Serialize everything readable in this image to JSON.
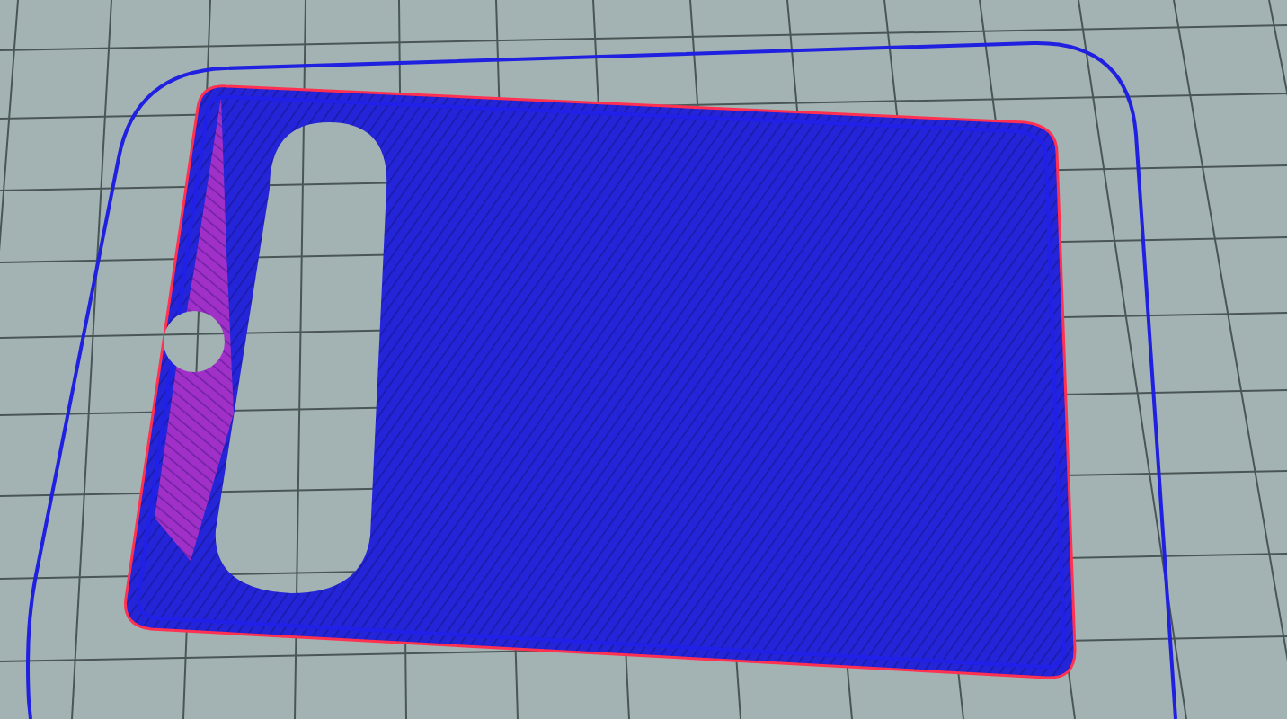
{
  "scene": {
    "kind": "layer-preview"
  }
}
